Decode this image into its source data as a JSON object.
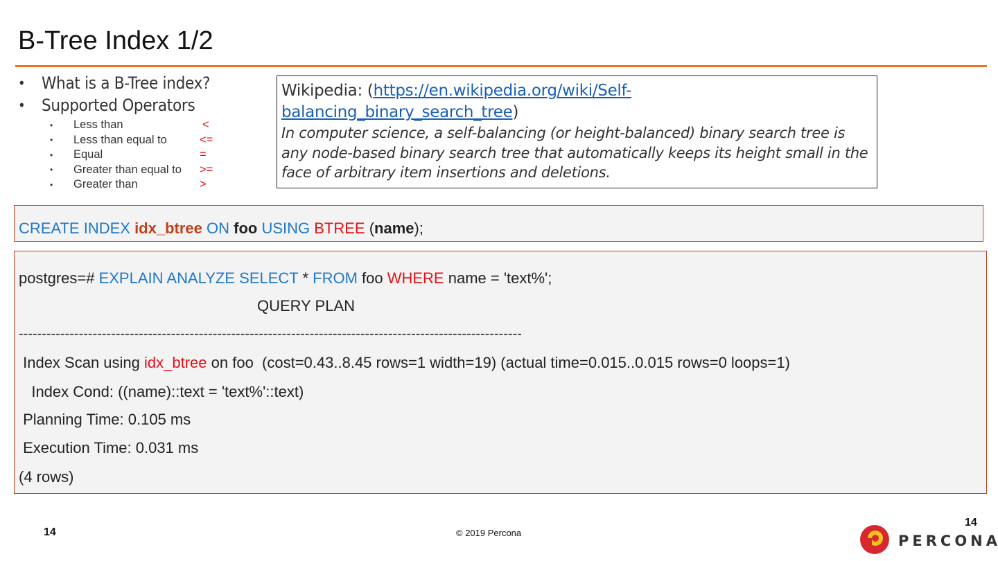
{
  "slide": {
    "title": "B-Tree Index 1/2"
  },
  "bullets": {
    "main": [
      "What is a B-Tree index?",
      "Supported Operators"
    ],
    "operators": [
      {
        "label": "Less than",
        "symbol": "<"
      },
      {
        "label": "Less than equal to",
        "symbol": "<="
      },
      {
        "label": "Equal",
        "symbol": "="
      },
      {
        "label": "Greater than equal to",
        "symbol": ">="
      },
      {
        "label": "Greater than",
        "symbol": ">"
      }
    ]
  },
  "wiki": {
    "prefix": "Wikipedia: (",
    "link_line1": "https://en.wikipedia.org/wiki/Self-",
    "link_line2": "balancing_binary_search_tree",
    "suffix": ")",
    "quote": "In computer science, a self-balancing (or height-balanced) binary search tree is any node-based binary search tree that automatically keeps its height small in the face of arbitrary item insertions and deletions."
  },
  "create_stmt": {
    "kw1": "CREATE INDEX ",
    "index_name": "idx_btree",
    "kw2": " ON ",
    "table": "foo",
    "kw3": " USING ",
    "method": "BTREE",
    "open": " (",
    "column": "name",
    "close": ");"
  },
  "explain": {
    "prompt": "postgres=# ",
    "kw1": "EXPLAIN ANALYZE SELECT",
    "star": " * ",
    "kw2": "FROM",
    "table": " foo ",
    "kw3": "WHERE",
    "cond": " name = 'text%';",
    "header": "QUERY PLAN",
    "separator": "-------------------------------------------------------------------------------------------------------------",
    "scan_prefix": " Index Scan using ",
    "scan_index": "idx_btree",
    "scan_suffix": " on foo  (cost=0.43..8.45 rows=1 width=19) (actual time=0.015..0.015 rows=0 loops=1)",
    "index_cond": "   Index Cond: ((name)::text = 'text%'::text)",
    "planning": " Planning Time: 0.105 ms",
    "execution": " Execution Time: 0.031 ms",
    "rows": "(4 rows)"
  },
  "footer": {
    "page_left": "14",
    "copyright": "© 2019 Percona",
    "page_right": "14",
    "logo_text": "PERCONA"
  },
  "colors": {
    "accent_orange": "#e9741c",
    "keyword_blue": "#1f78c8",
    "keyword_red": "#e0121a",
    "index_orange": "#c0411c",
    "code_bg": "#f3f3f3",
    "logo_red": "#d7282f",
    "logo_yellow": "#f5c21b"
  }
}
